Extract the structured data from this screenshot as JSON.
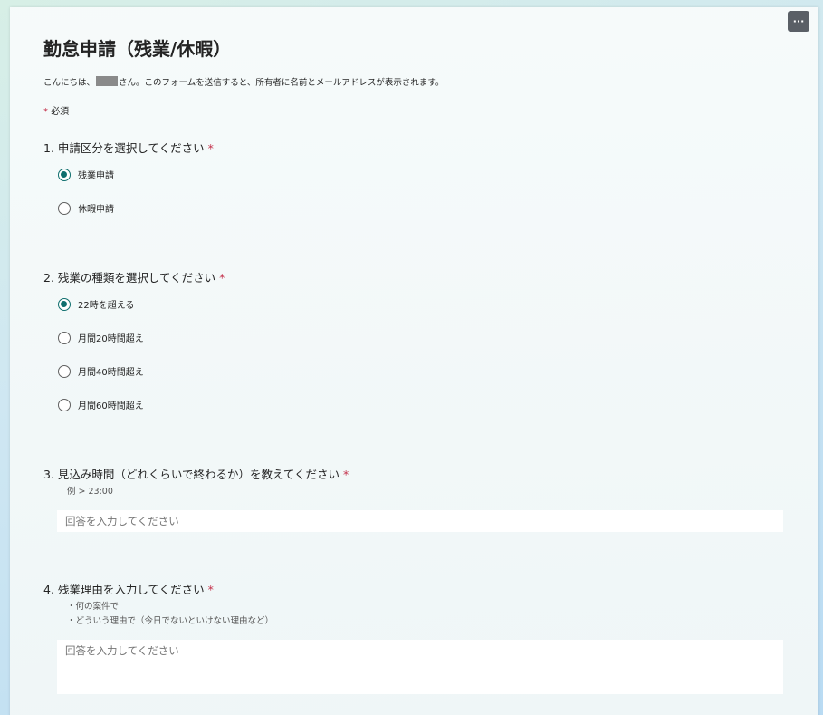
{
  "form": {
    "title": "勤怠申請（残業/休暇）",
    "greeting_before": "こんにちは、",
    "greeting_after": "さん。このフォームを送信すると、所有者に名前とメールアドレスが表示されます。",
    "required_star": "*",
    "required_label": "必須",
    "more_button_label": "···"
  },
  "questions": [
    {
      "title": "1. 申請区分を選択してください",
      "required": "*",
      "options": [
        {
          "label": "残業申請",
          "checked": true
        },
        {
          "label": "休暇申請",
          "checked": false
        }
      ]
    },
    {
      "title": "2. 残業の種類を選択してください",
      "required": "*",
      "options": [
        {
          "label": "22時を超える",
          "checked": true
        },
        {
          "label": "月間20時間超え",
          "checked": false
        },
        {
          "label": "月間40時間超え",
          "checked": false
        },
        {
          "label": "月間60時間超え",
          "checked": false
        }
      ]
    },
    {
      "title": "3. 見込み時間（どれくらいで終わるか）を教えてください",
      "required": "*",
      "hint": "例 > 23:00",
      "placeholder": "回答を入力してください"
    },
    {
      "title": "4. 残業理由を入力してください",
      "required": "*",
      "hint_lines": [
        "・何の案件で",
        "・どういう理由で（今日でないといけない理由など）"
      ],
      "placeholder": "回答を入力してください"
    }
  ],
  "colors": {
    "accent": "#0f6f6e",
    "required": "#c4314b"
  }
}
